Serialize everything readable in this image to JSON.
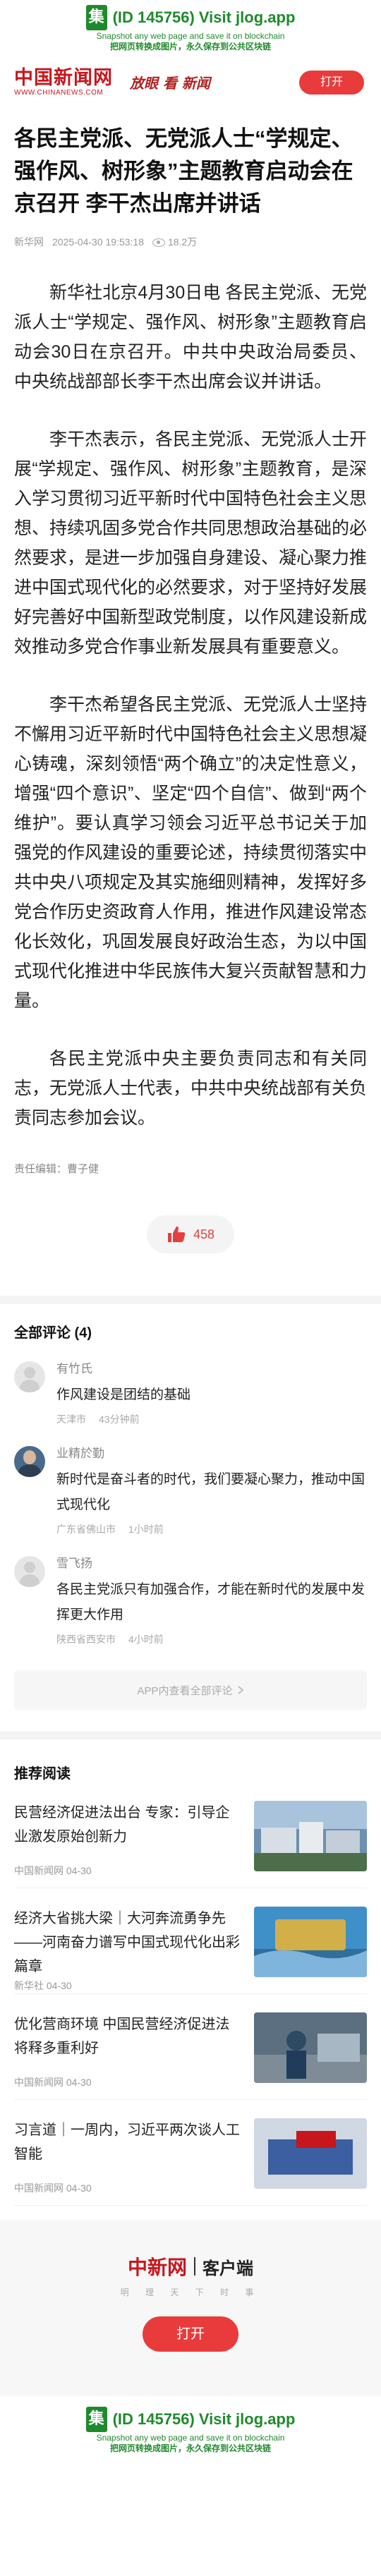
{
  "jlog": {
    "badge": "集",
    "line1": "(ID 145756) Visit jlog.app",
    "line2": "Snapshot any web page and save it on blockchain",
    "line3": "把网页转换成图片，永久保存到公共区块链"
  },
  "header": {
    "logo": "中国新闻网",
    "logo_en": "WWW.CHINANEWS.COM",
    "slogan": "放眼 看 新闻",
    "open_label": "打开"
  },
  "article": {
    "title": "各民主党派、无党派人士“学规定、强作风、树形象”主题教育启动会在京召开 李干杰出席并讲话",
    "source": "新华网",
    "datetime": "2025-04-30 19:53:18",
    "views": "18.2万",
    "paragraphs": [
      "新华社北京4月30日电 各民主党派、无党派人士“学规定、强作风、树形象”主题教育启动会30日在京召开。中共中央政治局委员、中央统战部部长李干杰出席会议并讲话。",
      "李干杰表示，各民主党派、无党派人士开展“学规定、强作风、树形象”主题教育，是深入学习贯彻习近平新时代中国特色社会主义思想、持续巩固多党合作共同思想政治基础的必然要求，是进一步加强自身建设、凝心聚力推进中国式现代化的必然要求，对于坚持好发展好完善好中国新型政党制度，以作风建设新成效推动多党合作事业新发展具有重要意义。",
      "李干杰希望各民主党派、无党派人士坚持不懈用习近平新时代中国特色社会主义思想凝心铸魂，深刻领悟“两个确立”的决定性意义，增强“四个意识”、坚定“四个自信”、做到“两个维护”。要认真学习领会习近平总书记关于加强党的作风建设的重要论述，持续贯彻落实中共中央八项规定及其实施细则精神，发挥好多党合作历史资政育人作用，推进作风建设常态化长效化，巩固发展良好政治生态，为以中国式现代化推进中华民族伟大复兴贡献智慧和力量。",
      "各民主党派中央主要负责同志和有关同志，无党派人士代表，中共中央统战部有关负责同志参加会议。"
    ],
    "editor": "责任编辑：曹子健",
    "likes": "458"
  },
  "comments": {
    "title": "全部评论 (4)",
    "items": [
      {
        "name": "有竹氏",
        "text": "作风建设是团结的基础",
        "location": "天津市",
        "time": "43分钟前",
        "avatar": "default-avatar"
      },
      {
        "name": "业精於勤",
        "text": "新时代是奋斗者的时代，我们要凝心聚力，推动中国式现代化",
        "location": "广东省佛山市",
        "time": "1小时前",
        "avatar": "photo-avatar"
      },
      {
        "name": "雪飞扬",
        "text": "各民主党派只有加强合作，才能在新时代的发展中发挥更大作用",
        "location": "陕西省西安市",
        "time": "4小时前",
        "avatar": "default-avatar"
      }
    ],
    "more_label": "APP内查看全部评论"
  },
  "recommend": {
    "title": "推荐阅读",
    "items": [
      {
        "headline": "民营经济促进法出台 专家：引导企业激发原始创新力",
        "source": "中国新闻网 04-30"
      },
      {
        "headline": "经济大省挑大梁｜大河奔流勇争先——河南奋力谱写中国式现代化出彩篇章",
        "source": "新华社 04-30"
      },
      {
        "headline": "优化营商环境 中国民营经济促进法将释多重利好",
        "source": "中国新闻网 04-30"
      },
      {
        "headline": "习言道｜一周内，习近平两次谈人工智能",
        "source": "中国新闻网 04-30"
      }
    ]
  },
  "bottom_promo": {
    "brand": "中新网",
    "client": "客户端",
    "slogan": "明 理 天 下 时 事",
    "open_label": "打开"
  },
  "colors": {
    "brand_red": "#c8161d",
    "button_red": "#e93b3b",
    "jlog_green": "#1f8a2c"
  }
}
